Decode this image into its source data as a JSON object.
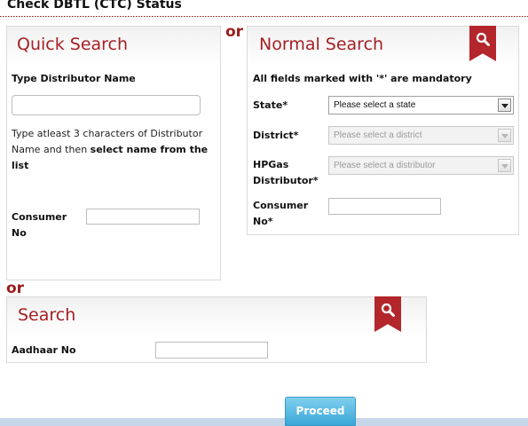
{
  "page": {
    "title": "Check DBTL (CTC) Status"
  },
  "quick_search": {
    "title": "Quick Search",
    "distributor_label": "Type Distributor Name",
    "distributor_value": "",
    "hint_prefix": "Type atleast 3 characters of Distributor Name and then ",
    "hint_bold": "select name from the list",
    "consumer_label_line1": "Consumer",
    "consumer_label_line2": "No",
    "consumer_value": ""
  },
  "separators": {
    "or_top": "or",
    "or_middle": "or"
  },
  "normal_search": {
    "title": "Normal Search",
    "mandatory_note": "All fields marked with '*' are mandatory",
    "state_label": "State*",
    "state_selected": "Please select a state",
    "district_label": "District*",
    "district_selected": "Please select a district",
    "distributor_label_line1": "HPGas",
    "distributor_label_line2": "Distributor*",
    "distributor_selected": "Please select a distributor",
    "consumer_label_line1": "Consumer",
    "consumer_label_line2": "No*",
    "consumer_value": ""
  },
  "aadhaar_search": {
    "title": "Search",
    "aadhaar_label": "Aadhaar No",
    "aadhaar_value": ""
  },
  "actions": {
    "proceed_label": "Proceed"
  },
  "icons": {
    "ribbon": "search-ribbon-icon",
    "magnifier": "search-icon"
  },
  "colors": {
    "accent_red": "#a51f24",
    "button_blue": "#4fb6e0"
  }
}
